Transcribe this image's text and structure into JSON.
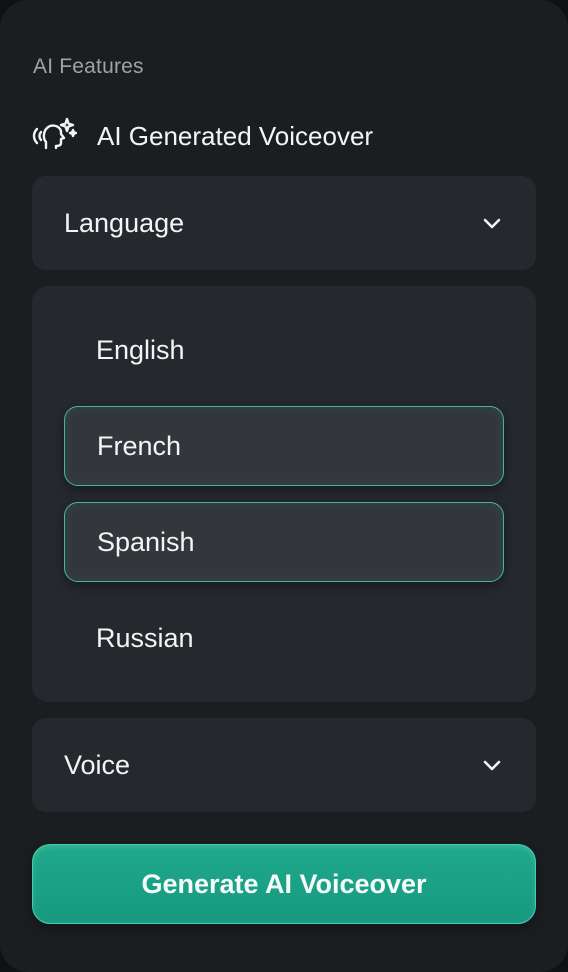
{
  "panel": {
    "section_label": "AI Features",
    "feature": {
      "icon": "ai-head-sparkle-icon",
      "title": "AI Generated Voiceover"
    }
  },
  "language_dropdown": {
    "label": "Language",
    "expanded": true,
    "icon": "chevron-down-icon"
  },
  "language_options": [
    {
      "label": "English",
      "selected": false
    },
    {
      "label": "French",
      "selected": true
    },
    {
      "label": "Spanish",
      "selected": true
    },
    {
      "label": "Russian",
      "selected": false
    }
  ],
  "voice_dropdown": {
    "label": "Voice",
    "expanded": false,
    "icon": "chevron-down-icon"
  },
  "generate_button": {
    "label": "Generate AI Voiceover"
  },
  "colors": {
    "panel_bg": "#1b1e21",
    "card_bg": "#25282c",
    "accent": "#1fa98c",
    "selected_border": "#3fb8a0",
    "muted_text": "#9ea3a8",
    "text": "#f2f4f5"
  }
}
